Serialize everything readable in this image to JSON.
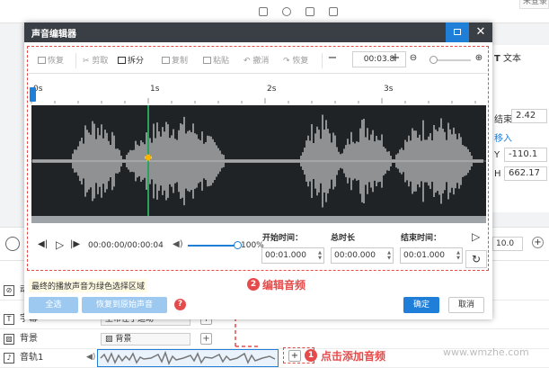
{
  "background": {
    "user_label": "未登录",
    "right_panel": {
      "text_tab": "文本",
      "end_label": "结束",
      "end_value": "2.42",
      "enter_label": "移入",
      "y_label": "Y",
      "y_value": "-110.1",
      "h_label": "H",
      "h_value": "662.17"
    },
    "zoom_value": "10.0",
    "tracks": [
      {
        "label": "动",
        "icon": "animation-icon"
      },
      {
        "label": "字幕",
        "clip": "上帝在于运动"
      },
      {
        "label": "背景",
        "clip": "背景"
      },
      {
        "label": "音轨1",
        "clip": ""
      }
    ]
  },
  "dialog": {
    "title": "声音编辑器",
    "toolbar": {
      "restore": "恢复",
      "cut": "剪取",
      "split": "拆分",
      "copy": "复制",
      "paste": "粘贴",
      "undo": "撤消",
      "redo": "恢复",
      "time": "00:03.8"
    },
    "ruler_ticks": [
      "0s",
      "1s",
      "2s",
      "3s"
    ],
    "player": {
      "time": "00:00:00/00:00:04",
      "volume": "100%",
      "volume_level": 1.0
    },
    "params": {
      "start_label": "开始时间：",
      "total_label": "总时长",
      "end_label": "结束时间：",
      "start_value": "00:01.000",
      "total_value": "00:00.000",
      "end_value": "00:01.000"
    },
    "hint": "最终的播放声音为绿色选择区域",
    "buttons": {
      "reset": "全选",
      "restore_original": "恢复到原始声音",
      "ok": "确定",
      "cancel": "取消"
    }
  },
  "annotations": {
    "step1_num": "1",
    "step1_text": "点击添加音频",
    "step2_num": "2",
    "step2_text": "编辑音频"
  },
  "watermark": "www.wmzhe.com",
  "colors": {
    "accent": "#1e7ed8",
    "annotation": "#e64b4b",
    "selection": "#2ecc71",
    "wave_bg": "#1f2326"
  }
}
